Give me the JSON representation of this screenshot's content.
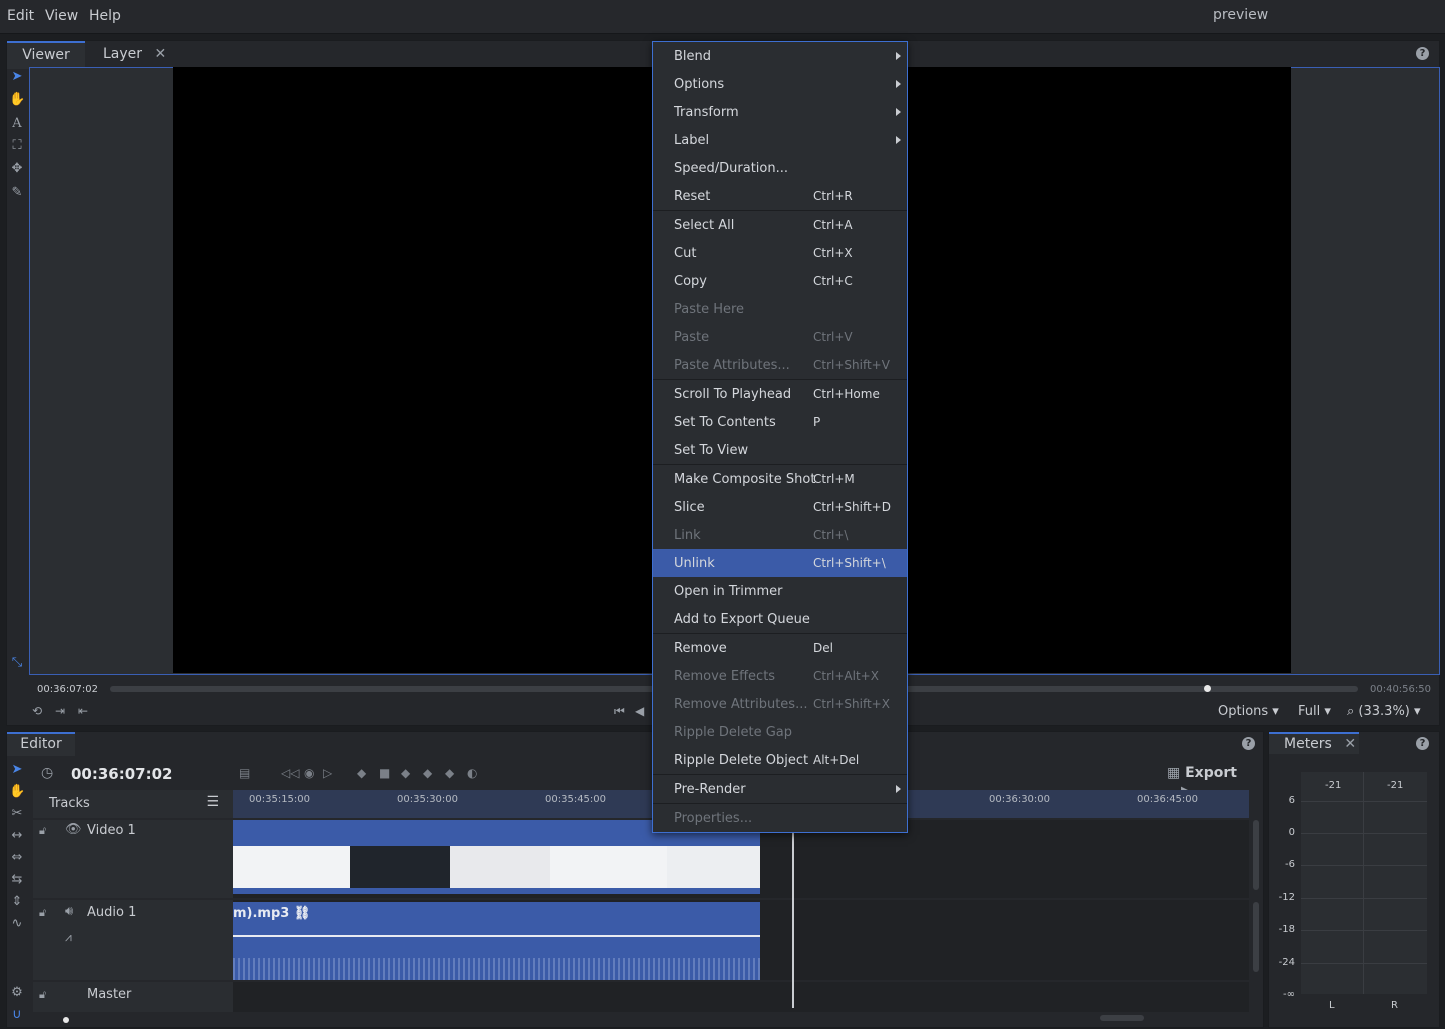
{
  "menubar": {
    "items": [
      "Edit",
      "View",
      "Help"
    ],
    "title": "preview"
  },
  "viewer": {
    "tabs": [
      {
        "label": "Viewer"
      },
      {
        "label": "Layer"
      }
    ],
    "current_time": "00:36:07:02",
    "end_time": "00:40:56:50",
    "options_label": "Options",
    "quality_label": "Full",
    "zoom_label": "(33.3%)"
  },
  "editor": {
    "tab": "Editor",
    "timecode": "00:36:07:02",
    "tracks_label": "Tracks",
    "export_label": "Export",
    "ruler": [
      "00:35:15:00",
      "00:35:30:00",
      "00:35:45:00",
      "00:36:30:00",
      "00:36:45:00"
    ],
    "tracks": [
      {
        "name": "Video 1"
      },
      {
        "name": "Audio 1",
        "clip_label": "m).mp3"
      },
      {
        "name": "Master"
      }
    ]
  },
  "meters": {
    "tab": "Meters",
    "peaks": [
      "-21",
      "-21"
    ],
    "scale": [
      "6",
      "0",
      "-6",
      "-12",
      "-18",
      "-24",
      "-∞"
    ],
    "channels": [
      "L",
      "R"
    ]
  },
  "context_menu": {
    "items": [
      {
        "label": "Blend",
        "shortcut": "",
        "submenu": true,
        "disabled": false
      },
      {
        "label": "Options",
        "shortcut": "",
        "submenu": true,
        "disabled": false
      },
      {
        "label": "Transform",
        "shortcut": "",
        "submenu": true,
        "disabled": false
      },
      {
        "label": "Label",
        "shortcut": "",
        "submenu": true,
        "disabled": false
      },
      {
        "label": "Speed/Duration...",
        "shortcut": "",
        "submenu": false,
        "disabled": false
      },
      {
        "label": "Reset",
        "shortcut": "Ctrl+R",
        "submenu": false,
        "disabled": false
      },
      {
        "label": "Select All",
        "shortcut": "Ctrl+A",
        "submenu": false,
        "disabled": false
      },
      {
        "label": "Cut",
        "shortcut": "Ctrl+X",
        "submenu": false,
        "disabled": false
      },
      {
        "label": "Copy",
        "shortcut": "Ctrl+C",
        "submenu": false,
        "disabled": false
      },
      {
        "label": "Paste Here",
        "shortcut": "",
        "submenu": false,
        "disabled": true
      },
      {
        "label": "Paste",
        "shortcut": "Ctrl+V",
        "submenu": false,
        "disabled": true
      },
      {
        "label": "Paste Attributes...",
        "shortcut": "Ctrl+Shift+V",
        "submenu": false,
        "disabled": true
      },
      {
        "label": "Scroll To Playhead",
        "shortcut": "Ctrl+Home",
        "submenu": false,
        "disabled": false
      },
      {
        "label": "Set To Contents",
        "shortcut": "P",
        "submenu": false,
        "disabled": false
      },
      {
        "label": "Set To View",
        "shortcut": "",
        "submenu": false,
        "disabled": false
      },
      {
        "label": "Make Composite Shot",
        "shortcut": "Ctrl+M",
        "submenu": false,
        "disabled": false
      },
      {
        "label": "Slice",
        "shortcut": "Ctrl+Shift+D",
        "submenu": false,
        "disabled": false
      },
      {
        "label": "Link",
        "shortcut": "Ctrl+\\",
        "submenu": false,
        "disabled": true
      },
      {
        "label": "Unlink",
        "shortcut": "Ctrl+Shift+\\",
        "submenu": false,
        "disabled": false,
        "highlighted": true
      },
      {
        "label": "Open in Trimmer",
        "shortcut": "",
        "submenu": false,
        "disabled": false
      },
      {
        "label": "Add to Export Queue",
        "shortcut": "",
        "submenu": false,
        "disabled": false
      },
      {
        "label": "Remove",
        "shortcut": "Del",
        "submenu": false,
        "disabled": false
      },
      {
        "label": "Remove Effects",
        "shortcut": "Ctrl+Alt+X",
        "submenu": false,
        "disabled": true
      },
      {
        "label": "Remove Attributes...",
        "shortcut": "Ctrl+Shift+X",
        "submenu": false,
        "disabled": true
      },
      {
        "label": "Ripple Delete Gap",
        "shortcut": "",
        "submenu": false,
        "disabled": true
      },
      {
        "label": "Ripple Delete Object",
        "shortcut": "Alt+Del",
        "submenu": false,
        "disabled": false
      },
      {
        "label": "Pre-Render",
        "shortcut": "",
        "submenu": true,
        "disabled": false
      },
      {
        "label": "Properties...",
        "shortcut": "",
        "submenu": false,
        "disabled": true
      }
    ]
  },
  "colors": {
    "accent": "#3d6fd1",
    "clip": "#3b5ba8",
    "highlight": "#3b5ba8"
  }
}
